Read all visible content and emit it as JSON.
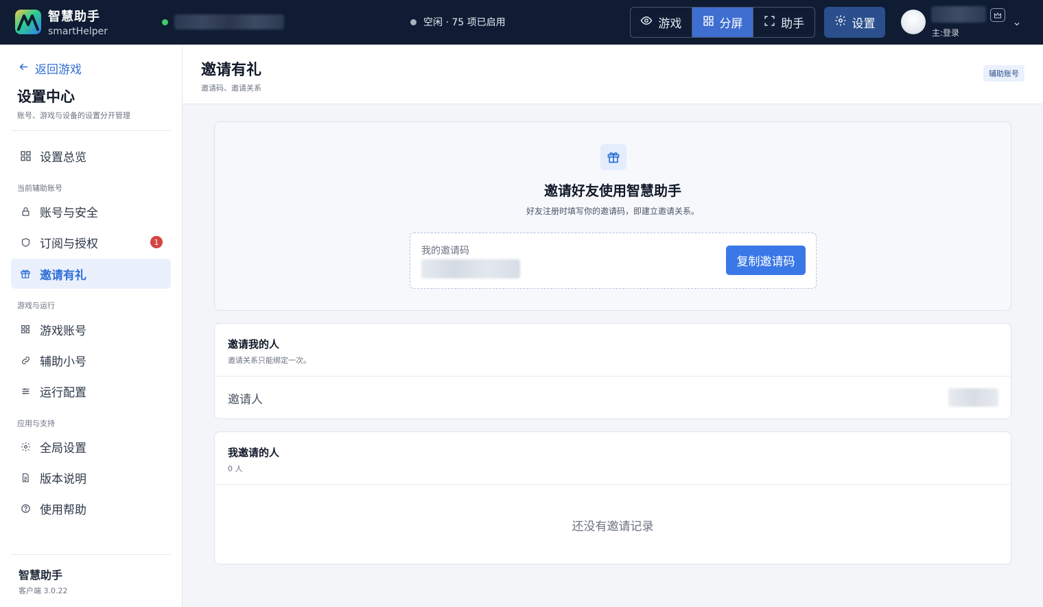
{
  "header": {
    "brand_name": "智慧助手",
    "brand_sub": "smartHelper",
    "status_text": "空闲 · 75 项已启用",
    "modes": [
      {
        "label": "游戏",
        "icon": "eye-icon",
        "active": false
      },
      {
        "label": "分屏",
        "icon": "grid-icon",
        "active": true
      },
      {
        "label": "助手",
        "icon": "expand-icon",
        "active": false
      }
    ],
    "settings_label": "设置",
    "user_sub": "主:登录"
  },
  "sidebar": {
    "back_label": "返回游戏",
    "title": "设置中心",
    "subtitle": "账号、游戏与设备的设置分开管理",
    "overview_label": "设置总览",
    "group1": "当前辅助账号",
    "items_g1": [
      {
        "label": "账号与安全",
        "icon": "lock-icon"
      },
      {
        "label": "订阅与授权",
        "icon": "shield-icon",
        "badge": "1"
      },
      {
        "label": "邀请有礼",
        "icon": "gift-icon",
        "active": true
      }
    ],
    "group2": "游戏与运行",
    "items_g2": [
      {
        "label": "游戏账号",
        "icon": "grid-icon"
      },
      {
        "label": "辅助小号",
        "icon": "link-icon"
      },
      {
        "label": "运行配置",
        "icon": "sliders-icon"
      }
    ],
    "group3": "应用与支持",
    "items_g3": [
      {
        "label": "全局设置",
        "icon": "gear-icon"
      },
      {
        "label": "版本说明",
        "icon": "document-icon"
      },
      {
        "label": "使用帮助",
        "icon": "help-icon"
      }
    ],
    "footer_name": "智慧助手",
    "footer_version": "客户端 3.0.22"
  },
  "page": {
    "title": "邀请有礼",
    "subtitle": "邀请码、邀请关系",
    "tag": "辅助账号"
  },
  "hero": {
    "title": "邀请好友使用智慧助手",
    "subtitle": "好友注册时填写你的邀请码，即建立邀请关系。",
    "code_label": "我的邀请码",
    "copy_label": "复制邀请码"
  },
  "inviter_section": {
    "title": "邀请我的人",
    "subtitle": "邀请关系只能绑定一次。",
    "row_label": "邀请人"
  },
  "invited_section": {
    "title": "我邀请的人",
    "count": "0 人",
    "empty": "还没有邀请记录"
  },
  "colors": {
    "topbar": "#0f1c33",
    "accent": "#3b78e7",
    "active_mode": "#3f6ed1",
    "badge": "#d64545",
    "online": "#3fca6b"
  }
}
